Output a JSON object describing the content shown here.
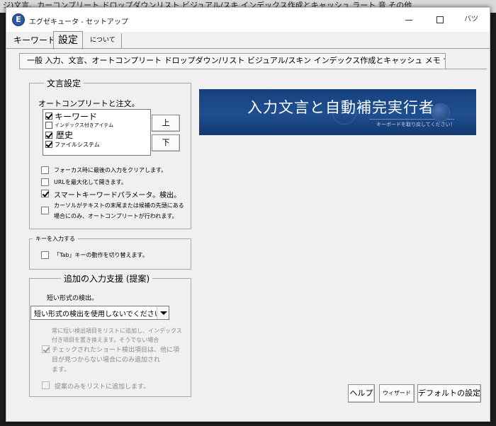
{
  "background_window": {
    "strip_text": "ジ)文言、カーコンプリート ドロップダウンリスト ビジュアル/スキ インデックス作成とキャッシュ      ラート         音          その他"
  },
  "window": {
    "title": "エグゼキュータ - セットアップ",
    "close_label": "バツ",
    "accent_color": "#1f4f91"
  },
  "main_tabs": {
    "keyword": "キーワード",
    "settings": "設定",
    "about": "について"
  },
  "sub_tabs": {
    "label": "一般 入力、文言、オートコンプリート ドロップダウン/リスト ビジュアル/スキン インデックス作成とキャッシュ メモ サウンド その他。"
  },
  "wording_group": {
    "title": "文言設定",
    "autocomplete_label": "オートコンプリートと注文。",
    "list_items": [
      {
        "label": "キーワード",
        "checked": true
      },
      {
        "label": "インデックス付きアイテム",
        "checked": false
      },
      {
        "label": "歴史",
        "checked": true
      },
      {
        "label": "ファイルシステム",
        "checked": true
      }
    ],
    "up_label": "上",
    "down_label": "下",
    "options": [
      {
        "label": "フォーカス時に最後の入力をクリアします。",
        "checked": false
      },
      {
        "label": "URLを最大化して開きます。",
        "checked": false
      },
      {
        "label": "スマートキーワードパラメータ。検出。",
        "checked": true
      },
      {
        "label_line1": "カーソルがテキストの末尾または候補の先頭にある",
        "label_line2": "場合にのみ、オートコンプリートが行われます。",
        "checked": false
      }
    ]
  },
  "keys_group": {
    "title": "キーを入力する",
    "tab_toggle_label": "「Tab」キーの動作を切り替えます。"
  },
  "suggest_group": {
    "title": "追加の入力支援 (提案)",
    "short_detect_label": "短い形式の検出。",
    "combo_value": "短い形式の検出を使用しないでください",
    "hint_line1": "常に短い検出項目をリストに追加し、インデックス",
    "hint_line2": "付き項目を置き換えます。そうでない場合",
    "checked_line1": "チェックされたショート検出項目は、他に項",
    "checked_line2": "目が見つからない場合にのみ追加され",
    "checked_line3": "ます。",
    "suggest_only_label": "提案のみをリストに追加します。"
  },
  "banner": {
    "title": "入力文言と自動補完実行者",
    "subtitle": "キーボードを取り戻してください！"
  },
  "footer": {
    "help": "ヘルプ",
    "wizard": "ウィザード",
    "default_settings": "デフォルトの設定"
  }
}
